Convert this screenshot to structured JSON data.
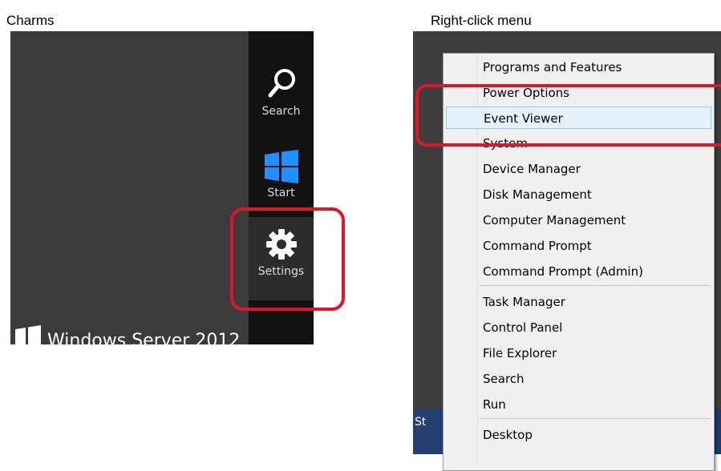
{
  "captions": {
    "charms": "Charms",
    "right_click": "Right-click  menu"
  },
  "charms": {
    "items": [
      {
        "name": "search",
        "label": "Search",
        "icon": "search-icon"
      },
      {
        "name": "start",
        "label": "Start",
        "icon": "windows-logo-icon"
      },
      {
        "name": "settings",
        "label": "Settings",
        "icon": "gear-icon"
      }
    ],
    "background_text": "Windows Server 2012",
    "accent": "#1e90ff"
  },
  "menu": {
    "items": [
      {
        "label": "Programs and Features"
      },
      {
        "label": "Power Options"
      },
      {
        "label": "Event Viewer",
        "selected": true
      },
      {
        "label": "System"
      },
      {
        "label": "Device Manager"
      },
      {
        "label": "Disk Management"
      },
      {
        "label": "Computer Management"
      },
      {
        "label": "Command Prompt"
      },
      {
        "label": "Command Prompt (Admin)"
      },
      {
        "label": "Task Manager"
      },
      {
        "label": "Control Panel"
      },
      {
        "label": "File Explorer"
      },
      {
        "label": "Search"
      },
      {
        "label": "Run"
      },
      {
        "label": "Desktop"
      }
    ],
    "taskbar_start_text": "St"
  },
  "highlight_color": "#e0142b"
}
